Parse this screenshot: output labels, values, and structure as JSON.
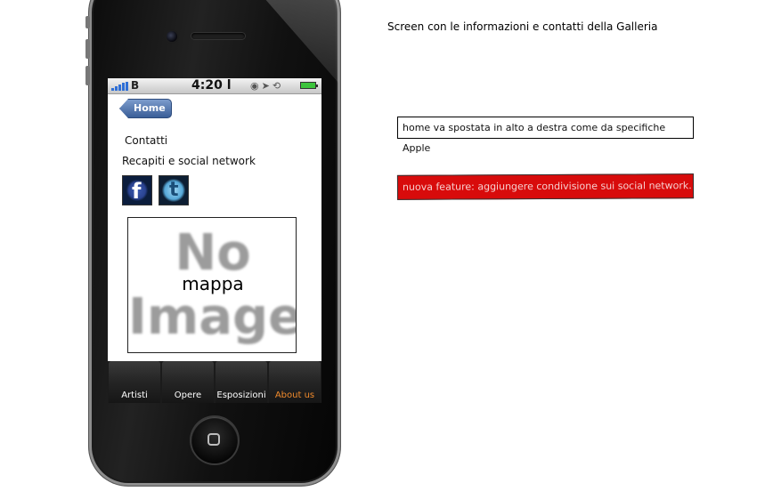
{
  "annotations": {
    "title": "Screen con le informazioni e contatti della Galleria",
    "note_home": "home va spostata in alto a destra come da specifiche Apple",
    "note_feature": "nuova feature: aggiungere condivisione sui social network."
  },
  "statusbar": {
    "carrier": "B",
    "time": "4:20",
    "time_suffix": "l"
  },
  "nav": {
    "back_label": "Home"
  },
  "content": {
    "heading": "Contatti",
    "subheading": "Recapiti e social network",
    "social": [
      {
        "name": "facebook",
        "icon": "facebook-icon",
        "glyph": "f"
      },
      {
        "name": "twitter",
        "icon": "twitter-icon",
        "glyph": "t"
      }
    ],
    "map": {
      "placeholder_line1": "No",
      "placeholder_line2": "Image",
      "label": "mappa"
    }
  },
  "tabbar": {
    "tabs": [
      {
        "label": "Artisti",
        "active": false
      },
      {
        "label": "Opere",
        "active": false
      },
      {
        "label": "Esposizioni",
        "active": false
      },
      {
        "label": "About us",
        "active": true
      }
    ],
    "active_color": "#f08a2c"
  },
  "colors": {
    "warning_note_bg": "#d80b0b",
    "back_button": "#4a6ea8"
  }
}
